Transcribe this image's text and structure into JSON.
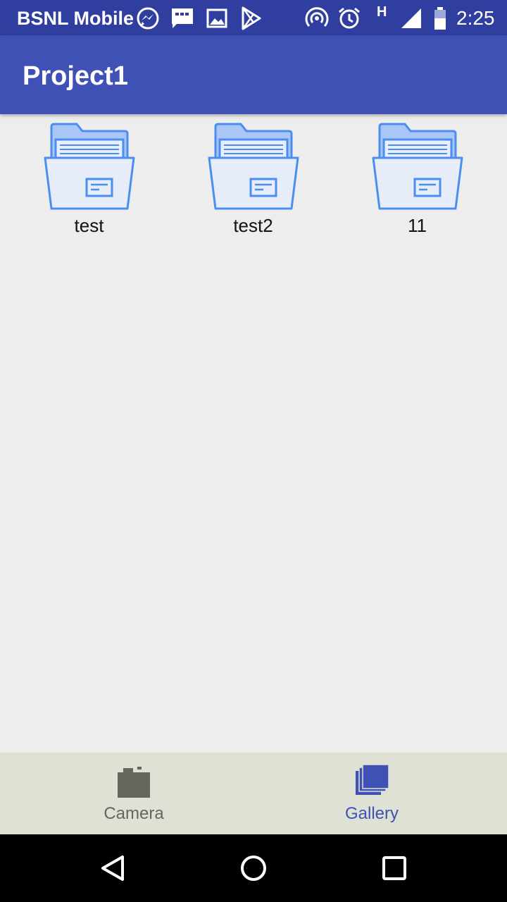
{
  "status_bar": {
    "carrier": "BSNL Mobile",
    "network_type": "H",
    "time": "2:25",
    "icons": [
      "messenger-icon",
      "sms-icon",
      "gallery-icon",
      "play-store-icon",
      "hotspot-icon",
      "alarm-icon",
      "signal-icon",
      "battery-icon"
    ]
  },
  "app_bar": {
    "title": "Project1"
  },
  "folders": [
    {
      "name": "test"
    },
    {
      "name": "test2"
    },
    {
      "name": "11"
    }
  ],
  "bottom_nav": {
    "tabs": [
      {
        "label": "Camera",
        "icon": "camera-icon",
        "active": false
      },
      {
        "label": "Gallery",
        "icon": "gallery-stack-icon",
        "active": true
      }
    ]
  },
  "system_nav": {
    "buttons": [
      "back-icon",
      "home-icon",
      "recents-icon"
    ]
  },
  "colors": {
    "status_bar": "#303f9f",
    "app_bar": "#3f51b5",
    "background": "#ededed",
    "bottom_nav": "#dee1d4",
    "active_tab": "#3f51b5",
    "inactive_tab": "#66665e",
    "folder_stroke": "#4a8ff0",
    "folder_fill": "#e6ecf8"
  }
}
